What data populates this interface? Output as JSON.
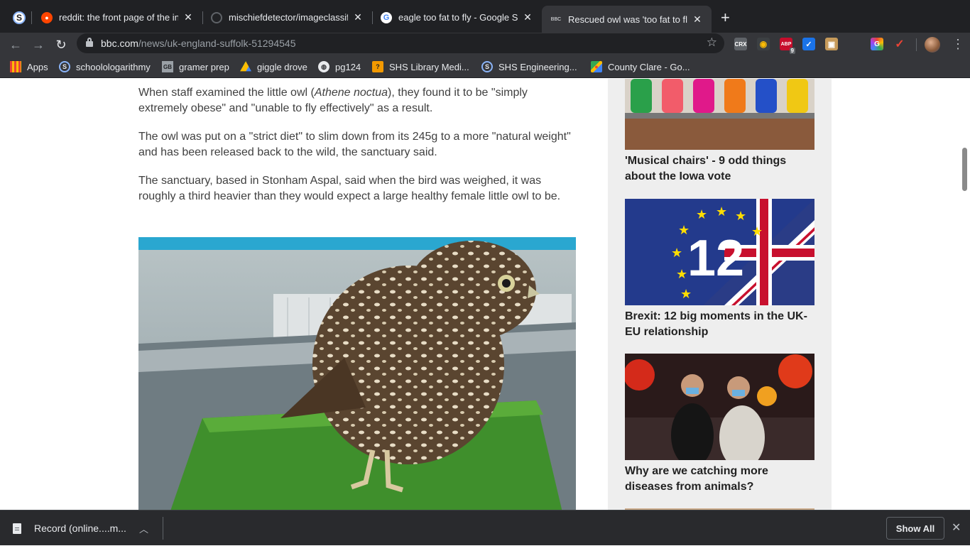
{
  "browser": {
    "profile_letter": "S",
    "tabs": [
      {
        "title": "reddit: the front page of the internet",
        "favicon_color": "#ff4500",
        "active": false
      },
      {
        "title": "mischiefdetector/imageclassifier",
        "favicon_color": "#202124",
        "active": false
      },
      {
        "title": "eagle too fat to fly - Google Search",
        "favicon_color": "#ffffff",
        "active": false
      },
      {
        "title": "Rescued owl was 'too fat to fly'",
        "favicon_label": "BBC",
        "active": true
      }
    ],
    "tab_close_glyph": "✕",
    "new_tab_glyph": "+",
    "url_domain": "bbc.com",
    "url_path": "/news/uk-england-suffolk-51294545",
    "extensions": [
      {
        "name": "crx-icon",
        "label": "CRX",
        "color": "#5f6368"
      },
      {
        "name": "owl-icon",
        "label": "◉",
        "color": "#3c4043"
      },
      {
        "name": "adblock-icon",
        "label": "ABP",
        "color": "#c70d2c",
        "badge": "9"
      },
      {
        "name": "checkmark-icon",
        "label": "✓",
        "color": "#1a73e8"
      },
      {
        "name": "box-icon",
        "label": "▣",
        "color": "#c69a5a"
      },
      {
        "name": "dark-extension-icon",
        "label": "",
        "color": "#35363a"
      },
      {
        "name": "color-picker-icon",
        "label": "G",
        "color": "#34a853"
      },
      {
        "name": "red-check-icon",
        "label": "✓",
        "color": "#ea4335"
      }
    ]
  },
  "bookmarks": [
    {
      "label": "Apps",
      "icon": "apps-grid-icon"
    },
    {
      "label": "schoolologarithmy",
      "icon": "schoology-icon"
    },
    {
      "label": "gramer prep",
      "icon": "gb-icon"
    },
    {
      "label": "giggle drove",
      "icon": "drive-icon"
    },
    {
      "label": "pg124",
      "icon": "globe-icon"
    },
    {
      "label": "SHS Library Medi...",
      "icon": "library-icon"
    },
    {
      "label": "SHS Engineering...",
      "icon": "schoology-icon"
    },
    {
      "label": "County Clare - Go...",
      "icon": "maps-icon"
    }
  ],
  "article": {
    "p1_before": "When staff examined the little owl (",
    "p1_italic": "Athene noctua",
    "p1_after": "), they found it to be \"simply extremely obese\" and \"unable to fly effectively\" as a result.",
    "p2": "The owl was put on a \"strict diet\" to slim down from its 245g to a more \"natural weight\" and has been released back to the wild, the sanctuary said.",
    "p3": "The sanctuary, based in Stonham Aspal, said when the bird was weighed, it was roughly a third heavier than they would expect a large healthy female little owl to be."
  },
  "sidebar": {
    "cards": [
      {
        "headline": "'Musical chairs' - 9 odd things about the Iowa vote"
      },
      {
        "headline": "Brexit: 12 big moments in the UK-EU relationship",
        "thumb_text": "12"
      },
      {
        "headline": "Why are we catching more diseases from animals?"
      }
    ]
  },
  "downloads": {
    "item_label": "Record (online....m...",
    "show_all": "Show All"
  }
}
